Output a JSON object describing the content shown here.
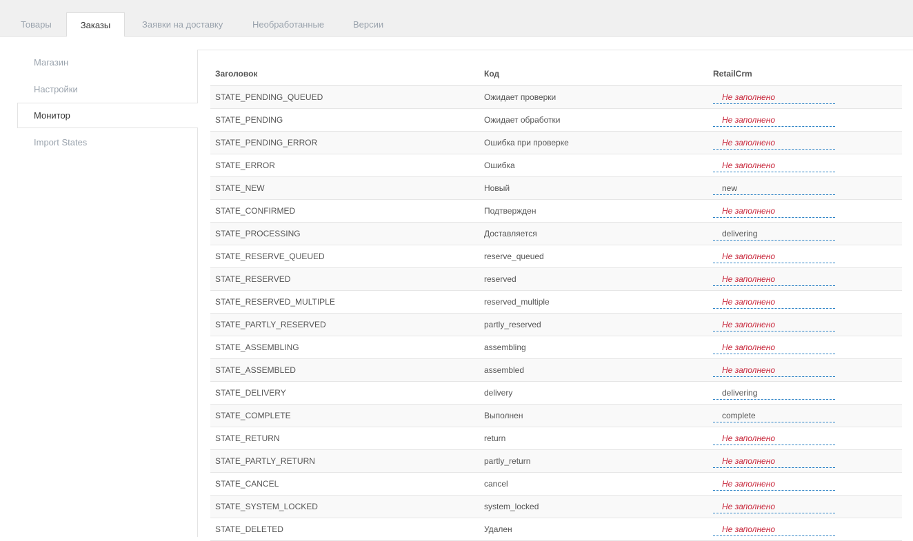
{
  "tabs": [
    {
      "label": "Товары"
    },
    {
      "label": "Заказы"
    },
    {
      "label": "Заявки на доставку"
    },
    {
      "label": "Необработанные"
    },
    {
      "label": "Версии"
    }
  ],
  "active_tab": "Заказы",
  "sidebar": {
    "items": [
      {
        "label": "Магазин"
      },
      {
        "label": "Настройки"
      },
      {
        "label": "Монитор"
      },
      {
        "label": "Import States"
      }
    ],
    "active": "Монитор"
  },
  "table": {
    "headers": [
      "Заголовок",
      "Код",
      "RetailCrm"
    ],
    "empty_label": "Не заполнено",
    "rows": [
      {
        "title": "STATE_PENDING_QUEUED",
        "code": "Ожидает проверки",
        "crm": "Не заполнено",
        "filled": false
      },
      {
        "title": "STATE_PENDING",
        "code": "Ожидает обработки",
        "crm": "Не заполнено",
        "filled": false
      },
      {
        "title": "STATE_PENDING_ERROR",
        "code": "Ошибка при проверке",
        "crm": "Не заполнено",
        "filled": false
      },
      {
        "title": "STATE_ERROR",
        "code": "Ошибка",
        "crm": "Не заполнено",
        "filled": false
      },
      {
        "title": "STATE_NEW",
        "code": "Новый",
        "crm": "new",
        "filled": true
      },
      {
        "title": "STATE_CONFIRMED",
        "code": "Подтвержден",
        "crm": "Не заполнено",
        "filled": false
      },
      {
        "title": "STATE_PROCESSING",
        "code": "Доставляется",
        "crm": "delivering",
        "filled": true
      },
      {
        "title": "STATE_RESERVE_QUEUED",
        "code": "reserve_queued",
        "crm": "Не заполнено",
        "filled": false
      },
      {
        "title": "STATE_RESERVED",
        "code": "reserved",
        "crm": "Не заполнено",
        "filled": false
      },
      {
        "title": "STATE_RESERVED_MULTIPLE",
        "code": "reserved_multiple",
        "crm": "Не заполнено",
        "filled": false
      },
      {
        "title": "STATE_PARTLY_RESERVED",
        "code": "partly_reserved",
        "crm": "Не заполнено",
        "filled": false
      },
      {
        "title": "STATE_ASSEMBLING",
        "code": "assembling",
        "crm": "Не заполнено",
        "filled": false
      },
      {
        "title": "STATE_ASSEMBLED",
        "code": "assembled",
        "crm": "Не заполнено",
        "filled": false
      },
      {
        "title": "STATE_DELIVERY",
        "code": "delivery",
        "crm": "delivering",
        "filled": true
      },
      {
        "title": "STATE_COMPLETE",
        "code": "Выполнен",
        "crm": "complete",
        "filled": true
      },
      {
        "title": "STATE_RETURN",
        "code": "return",
        "crm": "Не заполнено",
        "filled": false
      },
      {
        "title": "STATE_PARTLY_RETURN",
        "code": "partly_return",
        "crm": "Не заполнено",
        "filled": false
      },
      {
        "title": "STATE_CANCEL",
        "code": "cancel",
        "crm": "Не заполнено",
        "filled": false
      },
      {
        "title": "STATE_SYSTEM_LOCKED",
        "code": "system_locked",
        "crm": "Не заполнено",
        "filled": false
      },
      {
        "title": "STATE_DELETED",
        "code": "Удален",
        "crm": "Не заполнено",
        "filled": false
      }
    ]
  },
  "colors": {
    "empty_value": "#c8283c",
    "link_underline": "#2a81c5",
    "tab_inactive": "#9aa3ad",
    "tab_bar_bg": "#f0f0f0"
  }
}
